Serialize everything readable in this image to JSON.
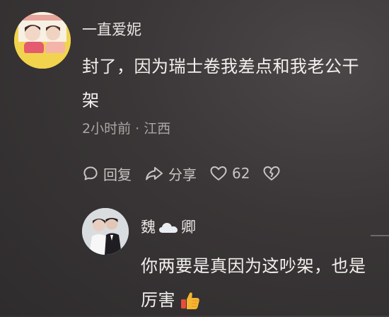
{
  "comment": {
    "username": "一直爱妮",
    "body": "封了，因为瑞士卷我差点和我老公干架",
    "meta": "2小时前 · 江西",
    "actions": {
      "reply_label": "回复",
      "share_label": "分享",
      "like_count": "62"
    }
  },
  "reply": {
    "username_part1": "魏",
    "username_part2": "卿",
    "body_part1": "你两要是真因为这吵架，也是",
    "body_part2": "厉害"
  },
  "icons": {
    "reply": "chat-bubble-icon",
    "share": "share-arrow-icon",
    "like": "heart-icon",
    "dislike": "broken-heart-icon",
    "emoji": "thumbs-up-icon",
    "name_decoration": "cloud-icon"
  },
  "colors": {
    "background": "#3a3637",
    "text_primary": "#f3f1ee",
    "text_secondary": "#aaa6a4",
    "avatar_main_bg": "#f1d34d"
  }
}
